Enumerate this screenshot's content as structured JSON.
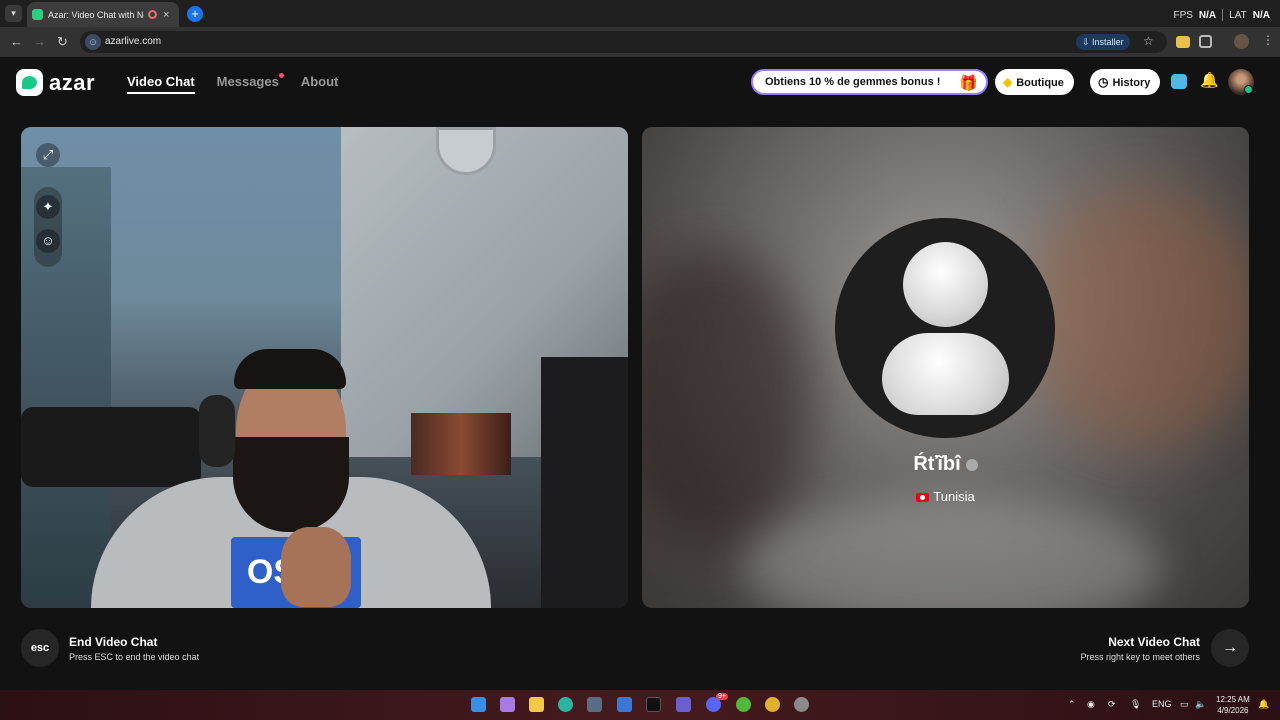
{
  "browser": {
    "tab_title": "Azar: Video Chat with New",
    "tab_close": "×",
    "newtab": "+",
    "fps_label": "FPS",
    "fps_value": "N/A",
    "lat_label": "LAT",
    "lat_value": "N/A",
    "url": "azarlive.com",
    "install_label": "Installer"
  },
  "header": {
    "logo_text": "azar",
    "nav": {
      "video_chat": "Video Chat",
      "messages": "Messages",
      "about": "About"
    },
    "promo": "Obtiens 10 % de gemmes bonus !",
    "shop": "Boutique",
    "history": "History"
  },
  "left_panel": {
    "shirt_text": "OSUH"
  },
  "peer": {
    "name": "Ŕťĩbî",
    "country": "Tunisia"
  },
  "controls": {
    "esc_label": "esc",
    "end_title": "End Video Chat",
    "end_sub": "Press ESC to end the video chat",
    "next_title": "Next Video Chat",
    "next_sub": "Press right key to meet others"
  },
  "taskbar": {
    "lang": "ENG",
    "time": "12:25 AM",
    "date": "4/9/2026",
    "discord_badge": "9+"
  },
  "colors": {
    "accent": "#19c98a",
    "promo_border": "#9b7bff",
    "notif_dot": "#ff4a6e"
  }
}
